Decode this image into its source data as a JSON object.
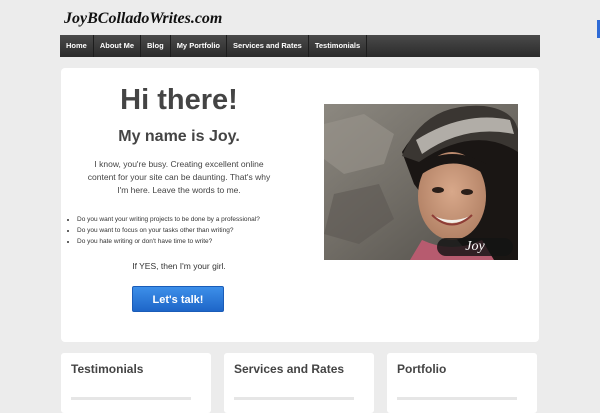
{
  "site": {
    "title": "JoyBColladoWrites.com"
  },
  "nav": {
    "items": [
      {
        "label": "Home"
      },
      {
        "label": "About Me"
      },
      {
        "label": "Blog"
      },
      {
        "label": "My Portfolio"
      },
      {
        "label": "Services and Rates"
      },
      {
        "label": "Testimonials"
      }
    ]
  },
  "hero": {
    "greeting": "Hi there!",
    "subheading": "My name is Joy.",
    "intro": "I know, you're busy. Creating excellent online content for your site can be daunting. That's why I'm here. Leave the words to me.",
    "bullets": [
      "Do you want your writing projects to be done by a professional?",
      "Do you want to focus on your tasks other than writing?",
      "Do you hate writing or don't have time to write?"
    ],
    "cta_text": "If YES, then I'm your girl.",
    "cta_button": "Let's talk!",
    "photo_caption": "Joy"
  },
  "cards": [
    {
      "title": "Testimonials"
    },
    {
      "title": "Services and Rates"
    },
    {
      "title": "Portfolio"
    }
  ]
}
